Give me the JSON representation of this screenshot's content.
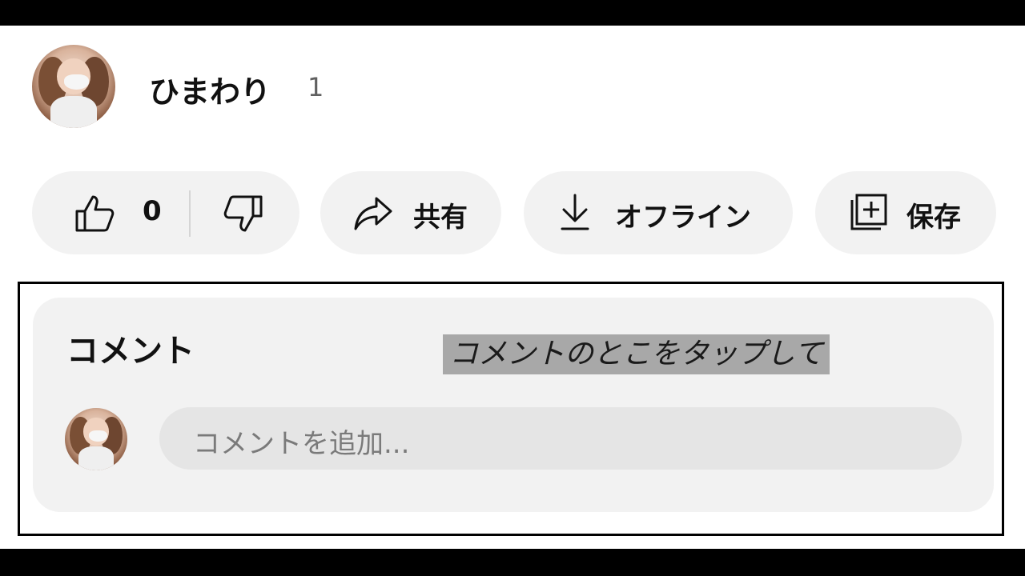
{
  "channel": {
    "name": "ひまわり",
    "subscriber_count": "1"
  },
  "actions": {
    "like_count": "0",
    "share_label": "共有",
    "download_label": "オフライン",
    "save_label": "保存"
  },
  "comments": {
    "title": "コメント",
    "overlay_hint": "コメントのとこをタップして",
    "input_placeholder": "コメントを追加..."
  },
  "icons": {
    "like": "thumbs-up-icon",
    "dislike": "thumbs-down-icon",
    "share": "share-arrow-icon",
    "download": "download-icon",
    "save": "add-to-playlist-icon"
  },
  "colors": {
    "pill_background": "#f2f2f2",
    "input_background": "#e5e5e5",
    "hint_background": "#a8a8a8"
  }
}
